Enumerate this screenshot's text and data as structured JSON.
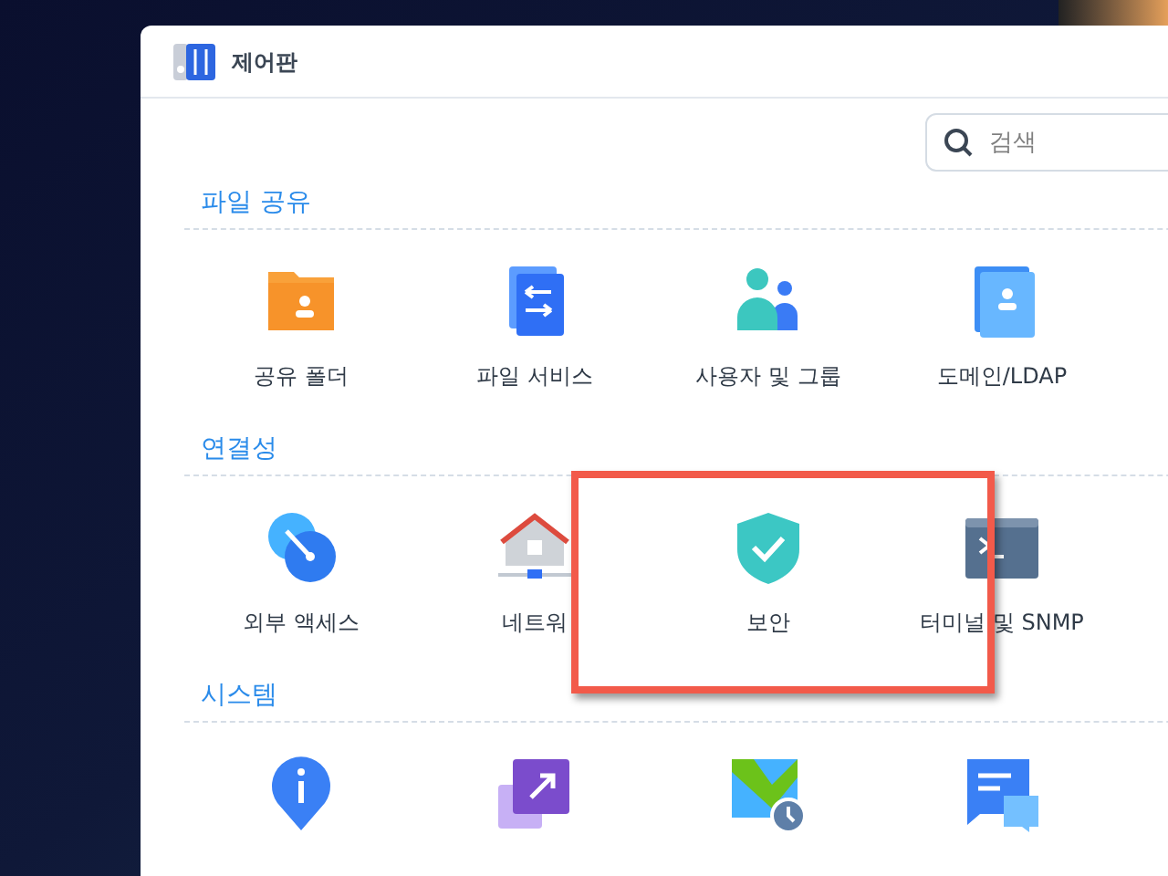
{
  "window": {
    "title": "제어판"
  },
  "search": {
    "placeholder": "검색"
  },
  "sections": [
    {
      "title": "파일 공유",
      "items": [
        {
          "label": "공유 폴더"
        },
        {
          "label": "파일 서비스"
        },
        {
          "label": "사용자 및 그룹"
        },
        {
          "label": "도메인/LDAP"
        }
      ]
    },
    {
      "title": "연결성",
      "items": [
        {
          "label": "외부 액세스"
        },
        {
          "label": "네트워"
        },
        {
          "label": "보안"
        },
        {
          "label": "터미널 및 SNMP"
        }
      ]
    },
    {
      "title": "시스템"
    }
  ],
  "highlight_frame": {
    "on": true
  }
}
